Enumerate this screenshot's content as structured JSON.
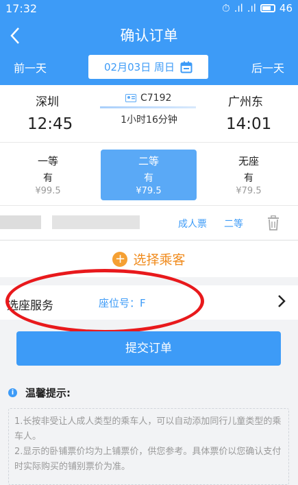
{
  "status_bar": {
    "time": "17:32",
    "signal_text": "4G",
    "battery": "46"
  },
  "header": {
    "title": "确认订单",
    "prev_day": "前一天",
    "next_day": "后一天",
    "date": "02月03日 周日"
  },
  "train": {
    "from_station": "深圳",
    "to_station": "广州东",
    "train_no": "C7192",
    "duration": "1小时16分钟",
    "depart_time": "12:45",
    "arrive_time": "14:01"
  },
  "seats": [
    {
      "name": "一等",
      "availability": "有",
      "price": "¥99.5"
    },
    {
      "name": "二等",
      "availability": "有",
      "price": "¥79.5"
    },
    {
      "name": "无座",
      "availability": "有",
      "price": "¥79.5"
    }
  ],
  "passenger": {
    "ticket_type": "成人票",
    "seat_class": "二等"
  },
  "select_passenger_label": "选择乘客",
  "seat_service": {
    "label": "选座服务",
    "value": "座位号：F"
  },
  "submit_label": "提交订单",
  "tips": {
    "title": "温馨提示:",
    "line1": "1.长按非受让人成人类型的乘车人，可以自动添加同行儿童类型的乘车人。",
    "line2": "2.显示的卧铺票价均为上铺票价，供您参考。具体票价以您确认支付时实际购买的铺别票价为准。"
  },
  "colors": {
    "primary": "#3d9bf7",
    "accent_orange": "#f08b1d",
    "annotation_red": "#e8191c"
  }
}
